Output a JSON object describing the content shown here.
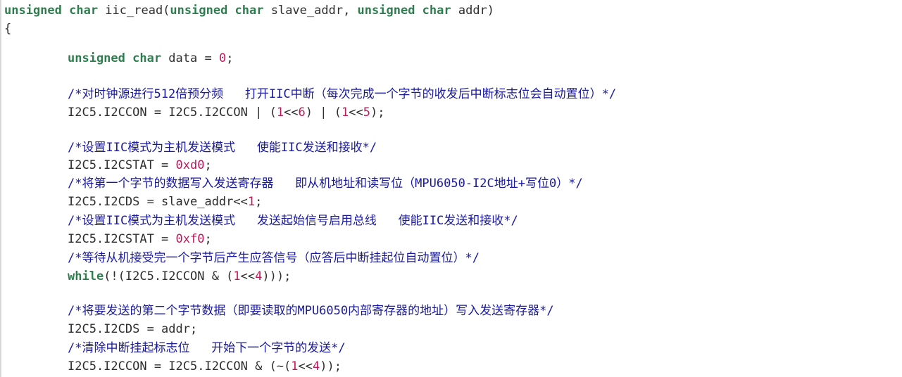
{
  "code": {
    "sig_kw1": "unsigned char",
    "sig_fn": " iic_read(",
    "sig_kw2": "unsigned char",
    "sig_p1": " slave_addr, ",
    "sig_kw3": "unsigned char",
    "sig_p2": " addr)",
    "brace_open": "{",
    "decl_kw": "unsigned char",
    "decl_rest_a": " data = ",
    "decl_num": "0",
    "decl_rest_b": ";",
    "c1": "/*对时钟源进行512倍预分频   打开IIC中断（每次完成一个字节的收发后中断标志位会自动置位）*/",
    "l1_a": "I2C5.I2CCON = I2C5.I2CCON | (",
    "l1_n1": "1",
    "l1_b": "<<",
    "l1_n2": "6",
    "l1_c": ") | (",
    "l1_n3": "1",
    "l1_d": "<<",
    "l1_n4": "5",
    "l1_e": ");",
    "c2": "/*设置IIC模式为主机发送模式   使能IIC发送和接收*/",
    "l2_a": "I2C5.I2CSTAT = ",
    "l2_n": "0xd0",
    "l2_b": ";",
    "c3": "/*将第一个字节的数据写入发送寄存器   即从机地址和读写位（MPU6050-I2C地址+写位0）*/",
    "l3_a": "I2C5.I2CDS = slave_addr<<",
    "l3_n": "1",
    "l3_b": ";",
    "c4": "/*设置IIC模式为主机发送模式   发送起始信号启用总线   使能IIC发送和接收*/",
    "l4_a": "I2C5.I2CSTAT = ",
    "l4_n": "0xf0",
    "l4_b": ";",
    "c5": "/*等待从机接受完一个字节后产生应答信号（应答后中断挂起位自动置位）*/",
    "l5_kw": "while",
    "l5_a": "(!(I2C5.I2CCON & (",
    "l5_n1": "1",
    "l5_b": "<<",
    "l5_n2": "4",
    "l5_c": ")));",
    "c6": "/*将要发送的第二个字节数据（即要读取的MPU6050内部寄存器的地址）写入发送寄存器*/",
    "l6": "I2C5.I2CDS = addr;",
    "c7": "/*清除中断挂起标志位   开始下一个字节的发送*/",
    "l7_a": "I2C5.I2CCON = I2C5.I2CCON & (~(",
    "l7_n1": "1",
    "l7_b": "<<",
    "l7_n2": "4",
    "l7_c": "));"
  },
  "colors": {
    "keyword": "#2f7d4f",
    "number": "#c2185b",
    "comment": "#1a1a9e"
  }
}
